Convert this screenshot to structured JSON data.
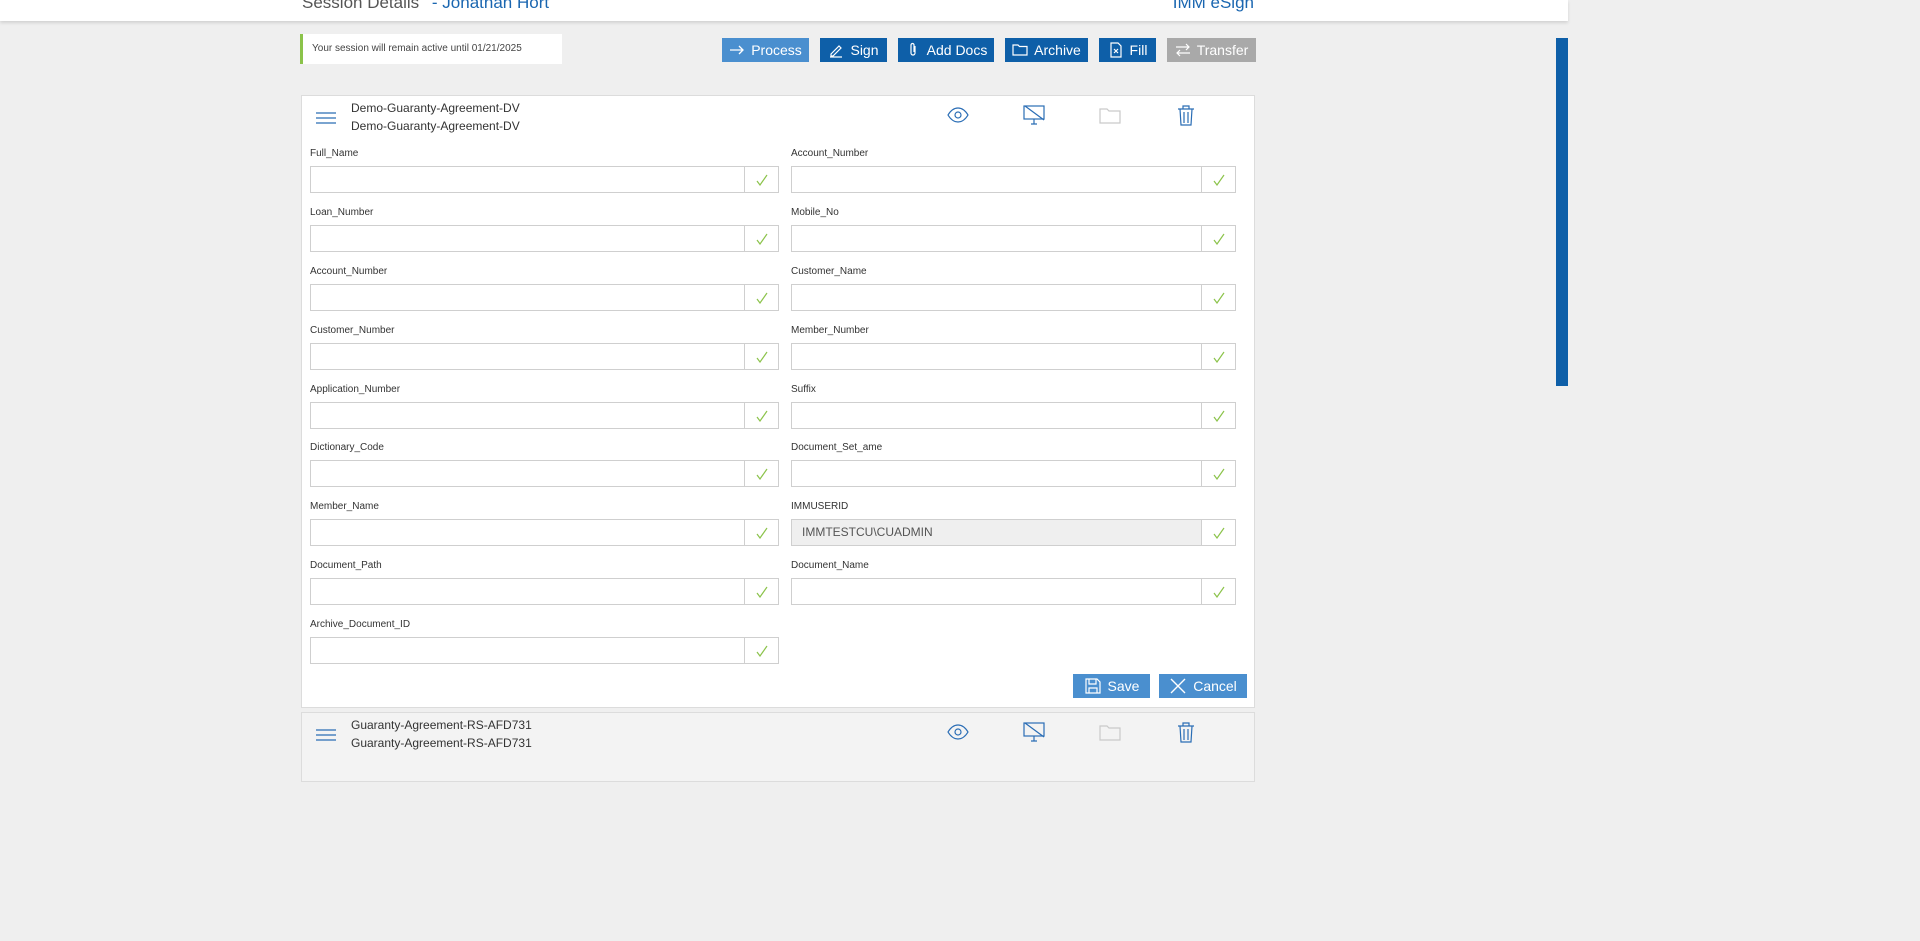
{
  "header": {
    "title": "Session Details",
    "name": "- Jonathan Hort",
    "brand": "IMM eSign"
  },
  "session_note": "Your session will remain active until 01/21/2025",
  "toolbar": {
    "process": "Process",
    "sign": "Sign",
    "add_docs": "Add Docs",
    "archive": "Archive",
    "fill": "Fill",
    "transfer": "Transfer"
  },
  "documents": [
    {
      "title1": "Demo-Guaranty-Agreement-DV",
      "title2": "Demo-Guaranty-Agreement-DV",
      "fields_left": [
        {
          "label": "Full_Name",
          "value": ""
        },
        {
          "label": "Loan_Number",
          "value": ""
        },
        {
          "label": "Account_Number",
          "value": ""
        },
        {
          "label": "Customer_Number",
          "value": ""
        },
        {
          "label": "Application_Number",
          "value": ""
        },
        {
          "label": "Dictionary_Code",
          "value": ""
        },
        {
          "label": "Member_Name",
          "value": ""
        },
        {
          "label": "Document_Path",
          "value": ""
        },
        {
          "label": "Archive_Document_ID",
          "value": ""
        }
      ],
      "fields_right": [
        {
          "label": "Account_Number",
          "value": ""
        },
        {
          "label": "Mobile_No",
          "value": ""
        },
        {
          "label": "Customer_Name",
          "value": ""
        },
        {
          "label": "Member_Number",
          "value": ""
        },
        {
          "label": "Suffix",
          "value": ""
        },
        {
          "label": "Document_Set_ame",
          "value": ""
        },
        {
          "label": "IMMUSERID",
          "value": "IMMTESTCU\\CUADMIN",
          "readonly": true
        },
        {
          "label": "Document_Name",
          "value": ""
        }
      ],
      "save": "Save",
      "cancel": "Cancel"
    },
    {
      "title1": "Guaranty-Agreement-RS-AFD731",
      "title2": "Guaranty-Agreement-RS-AFD731"
    }
  ],
  "colors": {
    "primary": "#0e5fa8",
    "light_primary": "#4a8fcf",
    "disabled": "#a9a9a9",
    "success_check": "#8bc34a"
  }
}
